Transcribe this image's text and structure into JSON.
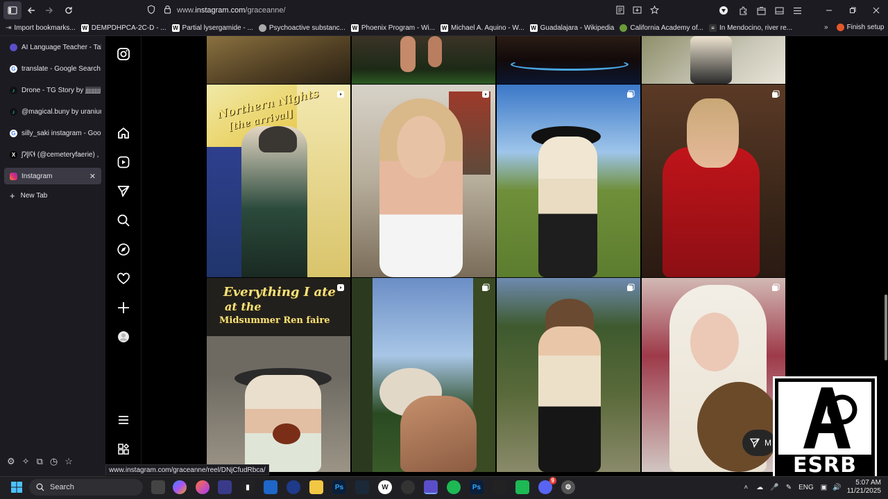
{
  "browser": {
    "url_prefix": "www.",
    "url_host": "instagram.com",
    "url_path": "/graceanne/",
    "status_url": "www.instagram.com/graceanne/reel/DNjCfudRbca/"
  },
  "bookmarks": [
    {
      "label": "Import bookmarks...",
      "icon": "import-icon"
    },
    {
      "label": "DEMPDHPCA-2C-D - ...",
      "icon": "wikipedia-icon"
    },
    {
      "label": "Partial lysergamide - ...",
      "icon": "wikipedia-icon"
    },
    {
      "label": "Psychoactive substanc...",
      "icon": "globe-icon"
    },
    {
      "label": "Phoenix Program - Wi...",
      "icon": "wikipedia-icon"
    },
    {
      "label": "Michael A. Aquino - W...",
      "icon": "wikipedia-icon"
    },
    {
      "label": "Guadalajara - Wikipedia",
      "icon": "wikipedia-icon"
    },
    {
      "label": "California Academy of...",
      "icon": "academy-icon"
    },
    {
      "label": "In Mendocino, river re...",
      "icon": "news-icon"
    }
  ],
  "bookmarks_more": "Finish setup",
  "tabs": [
    {
      "label": "AI Language Teacher - Talk",
      "icon": "talk-icon",
      "color": "#6b5bd6"
    },
    {
      "label": "translate - Google Search",
      "icon": "google-icon",
      "color": "#ffffff"
    },
    {
      "label": "Drone - TG Story by jjjjjjjjjj",
      "icon": "tiktok-icon",
      "color": "#111111"
    },
    {
      "label": "@magical.buny by uraniun",
      "icon": "tiktok-icon",
      "color": "#111111"
    },
    {
      "label": "silly_saki instagram - Goog",
      "icon": "google-icon",
      "color": "#ffffff"
    },
    {
      "label": "ʃʔɭǀʕɬ (@cemeteryfaerie) ,",
      "icon": "x-icon",
      "color": "#000000"
    },
    {
      "label": "Instagram",
      "icon": "instagram-icon",
      "color": "#e1306c",
      "active": true
    }
  ],
  "new_tab_label": "New Tab",
  "grid_overlays": {
    "tile1_line1": "Northern Nights",
    "tile1_line2": "[the arrival]",
    "tile2_line1": "Everything I ate",
    "tile2_line2": "at the",
    "tile2_line3": "Midsummer Ren faire"
  },
  "message_button": "M",
  "esrb": {
    "rating": "AO",
    "label": "ESRB"
  },
  "taskbar": {
    "search_placeholder": "Search",
    "lang": "ENG",
    "time": "5:07 AM",
    "date": "11/21/2025",
    "discord_badge": "9"
  }
}
